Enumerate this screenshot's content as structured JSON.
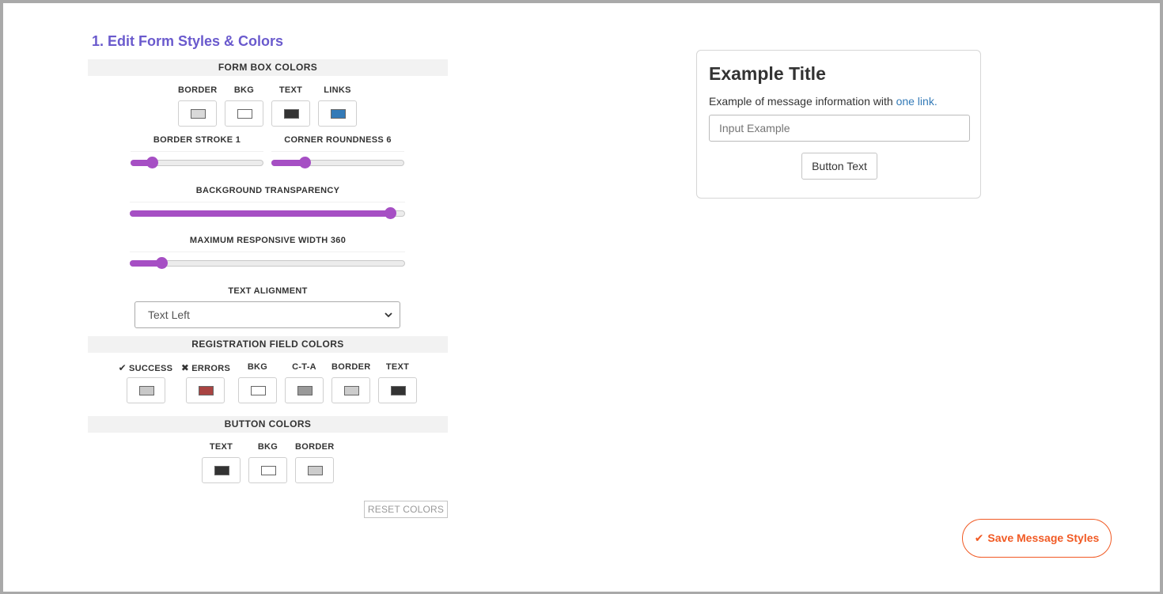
{
  "editor": {
    "title": "1. Edit Form Styles & Colors"
  },
  "form_box": {
    "heading": "FORM BOX COLORS",
    "swatches": [
      {
        "label": "BORDER",
        "color": "#d9d9d9"
      },
      {
        "label": "BKG",
        "color": "#ffffff"
      },
      {
        "label": "TEXT",
        "color": "#333333"
      },
      {
        "label": "LINKS",
        "color": "#337ab7"
      }
    ],
    "border_stroke_label": "BORDER STROKE 1",
    "border_stroke_fraction": 0.16,
    "corner_roundness_label": "CORNER ROUNDNESS 6",
    "corner_roundness_fraction": 0.25,
    "bg_transparency_label": "BACKGROUND TRANSPARENCY",
    "bg_transparency_fraction": 0.945,
    "max_width_label": "MAXIMUM RESPONSIVE WIDTH 360",
    "max_width_fraction": 0.115,
    "text_alignment_label": "TEXT ALIGNMENT",
    "text_alignment_value": "Text Left"
  },
  "registration": {
    "heading": "REGISTRATION FIELD COLORS",
    "swatches": [
      {
        "label": "SUCCESS",
        "icon": "check-icon",
        "color": "#c8c8c8"
      },
      {
        "label": "ERRORS",
        "icon": "x-icon",
        "color": "#a94442"
      },
      {
        "label": "BKG",
        "color": "#ffffff"
      },
      {
        "label": "C-T-A",
        "color": "#999999"
      },
      {
        "label": "BORDER",
        "color": "#cccccc"
      },
      {
        "label": "TEXT",
        "color": "#333333"
      }
    ]
  },
  "button_colors": {
    "heading": "BUTTON COLORS",
    "swatches": [
      {
        "label": "TEXT",
        "color": "#333333"
      },
      {
        "label": "BKG",
        "color": "#ffffff"
      },
      {
        "label": "BORDER",
        "color": "#cccccc"
      }
    ]
  },
  "reset_label": "RESET COLORS",
  "preview": {
    "title": "Example Title",
    "message": "Example of message information with ",
    "link_text": "one link.",
    "input_placeholder": "Input Example",
    "button_text": "Button Text"
  },
  "save_label": "Save Message Styles",
  "accent_color": "#a64fc4",
  "save_color": "#f15a24"
}
